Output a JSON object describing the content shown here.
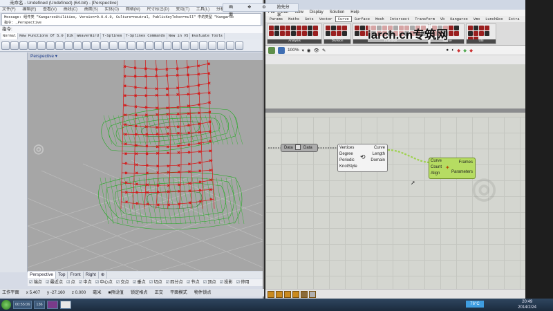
{
  "rhino": {
    "title": "未命名 - Undefined (Undefined) (64-bit) - [Perspective]",
    "menu": [
      "文件(F)",
      "编辑(E)",
      "查看(V)",
      "曲线(C)",
      "曲面(S)",
      "实体(O)",
      "网格(M)",
      "尺寸标注(D)",
      "变动(T)",
      "工具(L)",
      "分析(A)"
    ],
    "message_lines": [
      "Message: 组件类 \"KangarooUtilities, Version=0.0.0.0, Culture=neutral, PublicKeyToken=null\" 中的类型 \"Kangaroo",
      "指令: _Perspective"
    ],
    "command_prompt": "指令:",
    "toolbar_tabs": [
      "Normal",
      "New Functions Of 5.0",
      "Dik",
      "WeaverBird",
      "T-Splines",
      "T-Splines Commands",
      "New in V5",
      "Evaluate Tools"
    ],
    "toolbar_icons": [
      "new-icon",
      "open-icon",
      "save-icon",
      "print-icon",
      "import-icon",
      "cut-icon",
      "copy-icon",
      "paste-icon",
      "undo-icon",
      "redo-icon",
      "pan-icon",
      "rotate-icon",
      "zoom-icon",
      "zoom-window-icon",
      "zoom-extents-icon",
      "zoom-selected-icon",
      "4view-icon",
      "grid-icon",
      "cplane-icon",
      "layer-icon",
      "properties-icon",
      "lock-icon",
      "light-icon",
      "material-icon",
      "render-icon",
      "options-icon",
      "help-icon"
    ],
    "viewport_label": "Perspective",
    "viewport_tabs": [
      "Perspective",
      "Top",
      "Front",
      "Right"
    ],
    "viewport_add": "⊕",
    "osnaps": [
      "端点",
      "最近点",
      "点",
      "中点",
      "中心点",
      "交点",
      "垂点",
      "切点",
      "四分点",
      "节点",
      "顶点",
      "投影",
      "停用"
    ],
    "status": [
      "工作平面",
      "x 5.407",
      "y -27.160",
      "z 0.000",
      "毫米",
      "■预设值",
      "锁定格点",
      "正交",
      "平面模式",
      "物件锁点"
    ]
  },
  "grasshopper": {
    "menu": [
      "File",
      "Edit",
      "View",
      "Display",
      "Solution",
      "Help"
    ],
    "categories": [
      "Params",
      "Maths",
      "Sets",
      "Vector",
      "Curve",
      "Surface",
      "Mesh",
      "Intersect",
      "Transform",
      "Vb",
      "Kangaroo",
      "Vmo",
      "LunchBox",
      "Extra"
    ],
    "active_category": "Curve",
    "palette_groups": [
      "Analysis",
      "Division",
      "Primitive",
      "Spline",
      "Util"
    ],
    "zoom": "100%",
    "components": {
      "data_left": "Data",
      "data_right": "Data",
      "curve_inputs": [
        "Vertices",
        "Degree",
        "Periodic",
        "KnotStyle"
      ],
      "curve_outputs": [
        "Curve",
        "Length",
        "Domain"
      ],
      "frames_inputs": [
        "Curve",
        "Count",
        "Align"
      ],
      "frames_outputs": [
        "Frames",
        "Parameters"
      ]
    },
    "site_watermark": "iarch.cn专筑网",
    "mini_window": [
      "画面",
      "",
      "",
      ""
    ],
    "share_label": "抢先分享"
  },
  "taskbar": {
    "chips": [
      "00:55:06",
      "136"
    ],
    "temperature": "76°C",
    "time": "20:49",
    "date": "2014/2/24"
  },
  "colors": {
    "mesh_green": "#1fa81f",
    "mesh_red": "#d81414",
    "component_green": "#b6dc62",
    "accent_blue": "#1a3a8a"
  }
}
